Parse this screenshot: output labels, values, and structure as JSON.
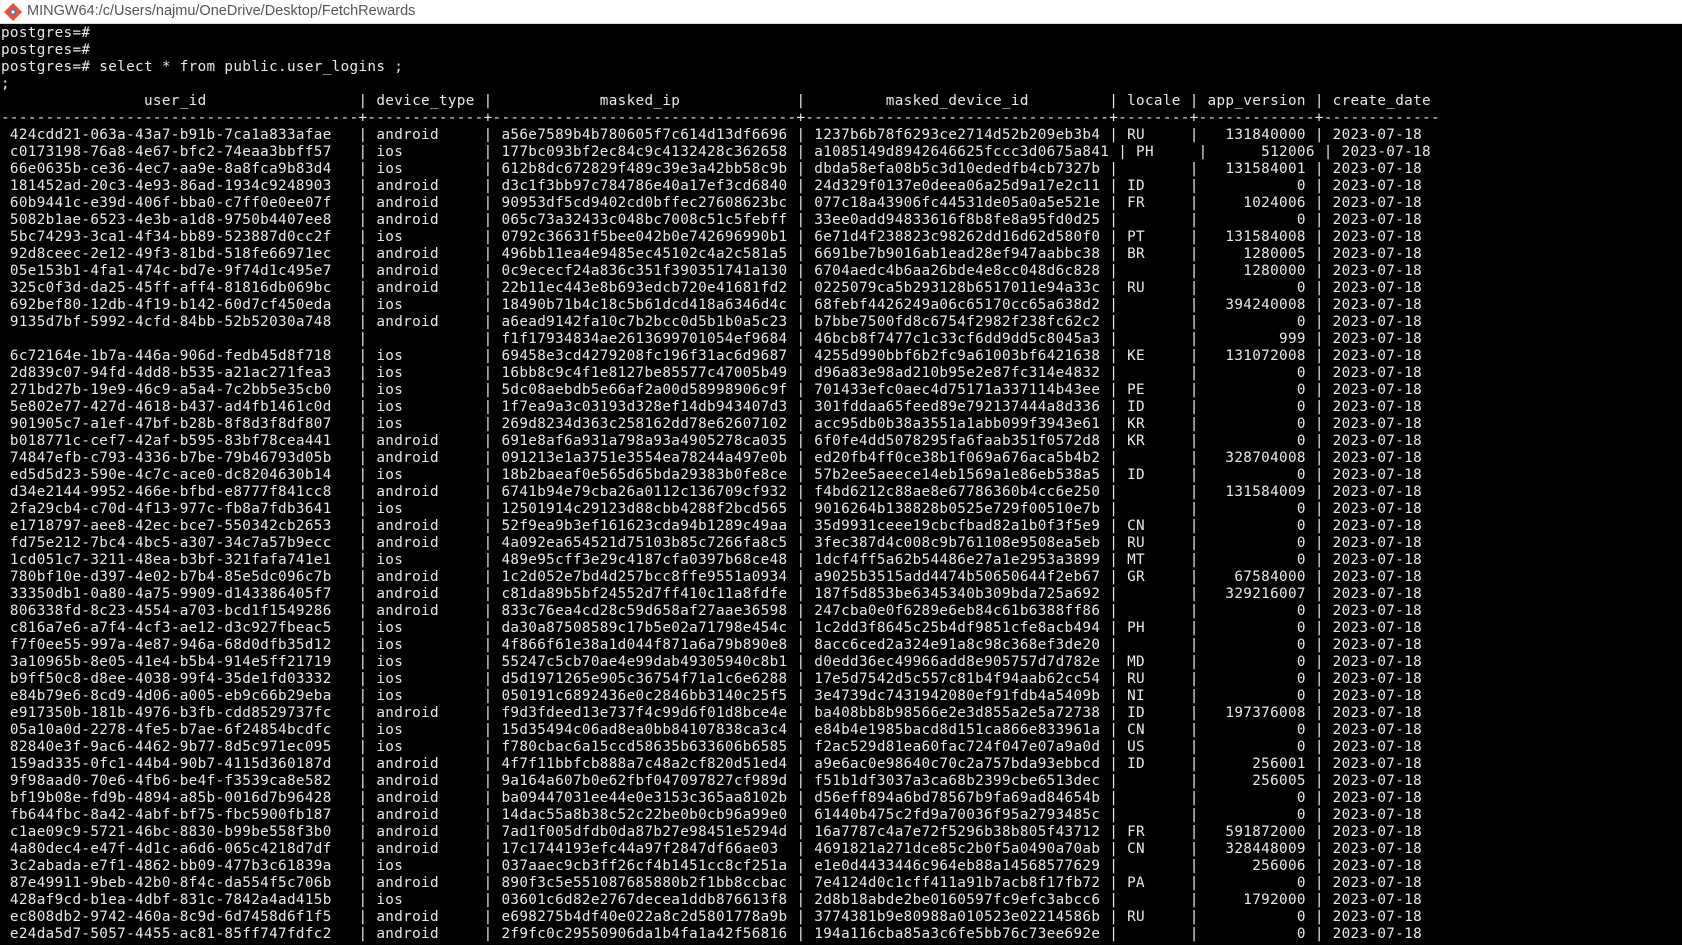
{
  "window": {
    "title": "MINGW64:/c/Users/najmu/OneDrive/Desktop/FetchRewards",
    "icon": "git-bash-icon"
  },
  "terminal": {
    "prompt_lines": [
      "postgres=#",
      "postgres=#",
      "postgres=# select * from public.user_logins ;",
      ";"
    ],
    "columns": [
      "user_id",
      "device_type",
      "masked_ip",
      "masked_device_id",
      "locale",
      "app_version",
      "create_date"
    ],
    "rows": [
      [
        "424cdd21-063a-43a7-b91b-7ca1a833afae",
        "android",
        "a56e7589b4b780605f7c614d13df6696",
        "1237b6b78f6293ce2714d52b209eb3b4",
        "RU",
        "131840000",
        "2023-07-18"
      ],
      [
        "c0173198-76a8-4e67-bfc2-74eaa3bbff57",
        "ios",
        "177bc093bf2ec84c9c4132428c362658",
        "a1085149d8942646625fccc3d0675a841",
        "PH",
        "512006",
        "2023-07-18"
      ],
      [
        "66e0635b-ce36-4ec7-aa9e-8a8fca9b83d4",
        "ios",
        "612b8dc672829f489c39e3a42bb58c9b",
        "dbda58efa08b5c3d10ededfb4cb7327b",
        "",
        "131584001",
        "2023-07-18"
      ],
      [
        "181452ad-20c3-4e93-86ad-1934c9248903",
        "android",
        "d3c1f3bb97c784786e40a17ef3cd6840",
        "24d329f0137e0deea06a25d9a17e2c11",
        "ID",
        "0",
        "2023-07-18"
      ],
      [
        "60b9441c-e39d-406f-bba0-c7ff0e0ee07f",
        "android",
        "90953df5cd9402cd0bffec27608623bc",
        "077c18a43906fc44531de05a0a5e521e",
        "FR",
        "1024006",
        "2023-07-18"
      ],
      [
        "5082b1ae-6523-4e3b-a1d8-9750b4407ee8",
        "android",
        "065c73a32433c048bc7008c51c5febff",
        "33ee0add94833616f8b8fe8a95fd0d25",
        "",
        "0",
        "2023-07-18"
      ],
      [
        "5bc74293-3ca1-4f34-bb89-523887d0cc2f",
        "ios",
        "0792c36631f5bee042b0e742696990b1",
        "6e71d4f238823c98262dd16d62d580f0",
        "PT",
        "131584008",
        "2023-07-18"
      ],
      [
        "92d8ceec-2e12-49f3-81bd-518fe66971ec",
        "android",
        "496bb11ea4e9485ec45102c4a2c581a5",
        "6691be7b9016ab1ead28ef947aabbc38",
        "BR",
        "1280005",
        "2023-07-18"
      ],
      [
        "05e153b1-4fa1-474c-bd7e-9f74d1c495e7",
        "android",
        "0c9ececf24a836c351f390351741a130",
        "6704aedc4b6aa26bde4e8cc048d6c828",
        "",
        "1280000",
        "2023-07-18"
      ],
      [
        "325c0f3d-da25-45ff-aff4-81816db069bc",
        "android",
        "22b11ec443e8b693edcb720e41681fd2",
        "0225079ca5b293128b6517011e94a33c",
        "RU",
        "0",
        "2023-07-18"
      ],
      [
        "692bef80-12db-4f19-b142-60d7cf450eda",
        "ios",
        "18490b71b4c18c5b61dcd418a6346d4c",
        "68febf4426249a06c65170cc65a638d2",
        "",
        "394240008",
        "2023-07-18"
      ],
      [
        "9135d7bf-5992-4cfd-84bb-52b52030a748",
        "android",
        "a6ead9142fa10c7b2bcc0d5b1b0a5c23",
        "b7bbe7500fd8c6754f2982f238fc62c2",
        "",
        "0",
        "2023-07-18"
      ],
      [
        "",
        "",
        "f1f17934834ae2613699701054ef9684",
        "46bcb8f7477c1c33cf6dd9dd5c8045a3",
        "",
        "999",
        "2023-07-18"
      ],
      [
        "6c72164e-1b7a-446a-906d-fedb45d8f718",
        "ios",
        "69458e3cd4279208fc196f31ac6d9687",
        "4255d990bbf6b2fc9a61003bf6421638",
        "KE",
        "131072008",
        "2023-07-18"
      ],
      [
        "2d839c07-94fd-4dd8-b535-a21ac271fea3",
        "ios",
        "16bb8c9c4f1e8127be85577c47005b49",
        "d96a83e98ad210b95e2e87fc314e4832",
        "",
        "0",
        "2023-07-18"
      ],
      [
        "271bd27b-19e9-46c9-a5a4-7c2bb5e35cb0",
        "ios",
        "5dc08aebdb5e66af2a00d58998906c9f",
        "701433efc0aec4d75171a337114b43ee",
        "PE",
        "0",
        "2023-07-18"
      ],
      [
        "5e802e77-427d-4618-b437-ad4fb1461c0d",
        "ios",
        "1f7ea9a3c03193d328ef14db943407d3",
        "301fddaa65feed89e792137444a8d336",
        "ID",
        "0",
        "2023-07-18"
      ],
      [
        "901905c7-a1ef-47bf-b28b-8f8d3f8df807",
        "ios",
        "269d8234d363c258162dd78e62607102",
        "acc95db0b38a3551a1abb099f3943e61",
        "KR",
        "0",
        "2023-07-18"
      ],
      [
        "b018771c-cef7-42af-b595-83bf78cea441",
        "android",
        "691e8af6a931a798a93a4905278ca035",
        "6f0fe4dd5078295fa6faab351f0572d8",
        "KR",
        "0",
        "2023-07-18"
      ],
      [
        "74847efb-c793-4336-b7be-79b46793d05b",
        "android",
        "091213e1a3751e3554ea78244a497e0b",
        "ed20fb4ff0ce38b1f069a676aca5b4b2",
        "",
        "328704008",
        "2023-07-18"
      ],
      [
        "ed5d5d23-590e-4c7c-ace0-dc8204630b14",
        "ios",
        "18b2baeaf0e565d65bda29383b0fe8ce",
        "57b2ee5aeece14eb1569a1e86eb538a5",
        "ID",
        "0",
        "2023-07-18"
      ],
      [
        "d34e2144-9952-466e-bfbd-e8777f841cc8",
        "android",
        "6741b94e79cba26a0112c136709cf932",
        "f4bd6212c88ae8e67786360b4cc6e250",
        "",
        "131584009",
        "2023-07-18"
      ],
      [
        "2fa29cb4-c70d-4f13-977c-fb8a7fdb3641",
        "ios",
        "12501914c29123d88cbb4288f2bcd565",
        "9016264b138828b0525e729f00510e7b",
        "",
        "0",
        "2023-07-18"
      ],
      [
        "e1718797-aee8-42ec-bce7-550342cb2653",
        "android",
        "52f9ea9b3ef161623cda94b1289c49aa",
        "35d9931ceee19cbcfbad82a1b0f3f5e9",
        "CN",
        "0",
        "2023-07-18"
      ],
      [
        "fd75e212-7bc4-4bc5-a307-34c7a57b9ecc",
        "android",
        "4a092ea654521d75103b85c7266fa8c5",
        "3fec387d4c008c9b761108e9508ea5eb",
        "RU",
        "0",
        "2023-07-18"
      ],
      [
        "1cd051c7-3211-48ea-b3bf-321fafa741e1",
        "ios",
        "489e95cff3e29c4187cfa0397b68ce48",
        "1dcf4ff5a62b54486e27a1e2953a3899",
        "MT",
        "0",
        "2023-07-18"
      ],
      [
        "780bf10e-d397-4e02-b7b4-85e5dc096c7b",
        "android",
        "1c2d052e7bd4d257bcc8ffe9551a0934",
        "a9025b3515add4474b50650644f2eb67",
        "GR",
        "67584000",
        "2023-07-18"
      ],
      [
        "33350db1-0a80-4a75-9909-d143386405f7",
        "android",
        "c81da89b5bf24552d7ff410c11a8fdfe",
        "187f5d853be6345340b309bda725a692",
        "",
        "329216007",
        "2023-07-18"
      ],
      [
        "806338fd-8c23-4554-a703-bcd1f1549286",
        "android",
        "833c76ea4cd28c59d658af27aae36598",
        "247cba0e0f6289e6eb84c61b6388ff86",
        "",
        "0",
        "2023-07-18"
      ],
      [
        "c816a7e6-a7f4-4cf3-ae12-d3c927fbeac5",
        "ios",
        "da30a87508589c17b5e02a71798e454c",
        "1c2dd3f8645c25b4df9851cfe8acb494",
        "PH",
        "0",
        "2023-07-18"
      ],
      [
        "f7f0ee55-997a-4e87-946a-68d0dfb35d12",
        "ios",
        "4f866f61e38a1d044f871a6a79b890e8",
        "8acc6ced2a324e91a8c98c368ef3de20",
        "",
        "0",
        "2023-07-18"
      ],
      [
        "3a10965b-8e05-41e4-b5b4-914e5ff21719",
        "ios",
        "55247c5cb70ae4e99dab49305940c8b1",
        "d0edd36ec49966add8e905757d7d782e",
        "MD",
        "0",
        "2023-07-18"
      ],
      [
        "b9ff50c8-d8ee-4038-99f4-35de1fd03332",
        "ios",
        "d5d1971265e905c36754f71a1c6e6288",
        "17e5d7542d5c557c81b4f94aab62cc54",
        "RU",
        "0",
        "2023-07-18"
      ],
      [
        "e84b79e6-8cd9-4d06-a005-eb9c66b29eba",
        "ios",
        "050191c6892436e0c2846bb3140c25f5",
        "3e4739dc7431942080ef91fdb4a5409b",
        "NI",
        "0",
        "2023-07-18"
      ],
      [
        "e917350b-181b-4976-b3fb-cdd8529737fc",
        "android",
        "f9d3fdeed13e737f4c99d6f01d8bce4e",
        "ba408bb8b98566e2e3d855a2e5a72738",
        "ID",
        "197376008",
        "2023-07-18"
      ],
      [
        "05a10a0d-2278-4fe5-b7ae-6f24854bcdfc",
        "ios",
        "15d35494c06ad8ea0bb84107838ca3c4",
        "e84b4e1985bacd8d151ca866e833961a",
        "CN",
        "0",
        "2023-07-18"
      ],
      [
        "82840e3f-9ac6-4462-9b77-8d5c971ec095",
        "ios",
        "f780cbac6a15ccd58635b633606b6585",
        "f2ac529d81ea60fac724f047e07a9a0d",
        "US",
        "0",
        "2023-07-18"
      ],
      [
        "159ad335-0fc1-44b4-90b7-4115d360187d",
        "android",
        "4f7f11bbfcb888a7c48a2cf820d51ed4",
        "a9e6ac0e98640c70c2a757bda93ebbcd",
        "ID",
        "256001",
        "2023-07-18"
      ],
      [
        "9f98aad0-70e6-4fb6-be4f-f3539ca8e582",
        "android",
        "9a164a607b0e62fbf047097827cf989d",
        "f51b1df3037a3ca68b2399cbe6513dec",
        "",
        "256005",
        "2023-07-18"
      ],
      [
        "bf19b08e-fd9b-4894-a85b-0016d7b96428",
        "android",
        "ba09447031ee44e0e3153c365aa8102b",
        "d56eff894a6bd78567b9fa69ad84654b",
        "",
        "0",
        "2023-07-18"
      ],
      [
        "fb644fbc-8a42-4abf-bf75-fbc5900fb187",
        "android",
        "14dac55a8b38c52c22be0b0cb96a99e0",
        "61440b475c2fd9a70036f95a2793485c",
        "",
        "0",
        "2023-07-18"
      ],
      [
        "c1ae09c9-5721-46bc-8830-b99be558f3b0",
        "android",
        "7ad1f005dfdb0da87b27e98451e5294d",
        "16a7787c4a7e72f5296b38b805f43712",
        "FR",
        "591872000",
        "2023-07-18"
      ],
      [
        "4a80dec4-e47f-4d1c-a6d6-065c4218d7df",
        "android",
        "17c1744193efc44a97f2847df66ae03",
        "4691821a271dce85c2b0f5a0490a70ab",
        "CN",
        "328448009",
        "2023-07-18"
      ],
      [
        "3c2abada-e7f1-4862-bb09-477b3c61839a",
        "ios",
        "037aaec9cb3ff26cf4b1451cc8cf251a",
        "e1e0d4433446c964eb88a14568577629",
        "",
        "256006",
        "2023-07-18"
      ],
      [
        "87e49911-9beb-42b0-8f4c-da554f5c706b",
        "android",
        "890f3c5e551087685880b2f1bb8ccbac",
        "7e4124d0c1cff411a91b7acb8f17fb72",
        "PA",
        "0",
        "2023-07-18"
      ],
      [
        "428af9cd-b1ea-4dbf-831c-7842a4ad415b",
        "ios",
        "03601c6d82e2767decea1ddb876613f8",
        "2d8b18abde2be0160597fc9efc3abcc6",
        "",
        "1792000",
        "2023-07-18"
      ],
      [
        "ec808db2-9742-460a-8c9d-6d7458d6f1f5",
        "android",
        "e698275b4df40e022a8c2d5801778a9b",
        "3774381b9e80988a010523e02214586b",
        "RU",
        "0",
        "2023-07-18"
      ],
      [
        "e24da5d7-5057-4455-ac81-85ff747fdfc2",
        "android",
        "2f9fc0c29550906da1b4fa1a42f56816",
        "194a116cba85a3c6fe5bb76c73ee692e",
        "",
        "0",
        "2023-07-18"
      ]
    ]
  }
}
